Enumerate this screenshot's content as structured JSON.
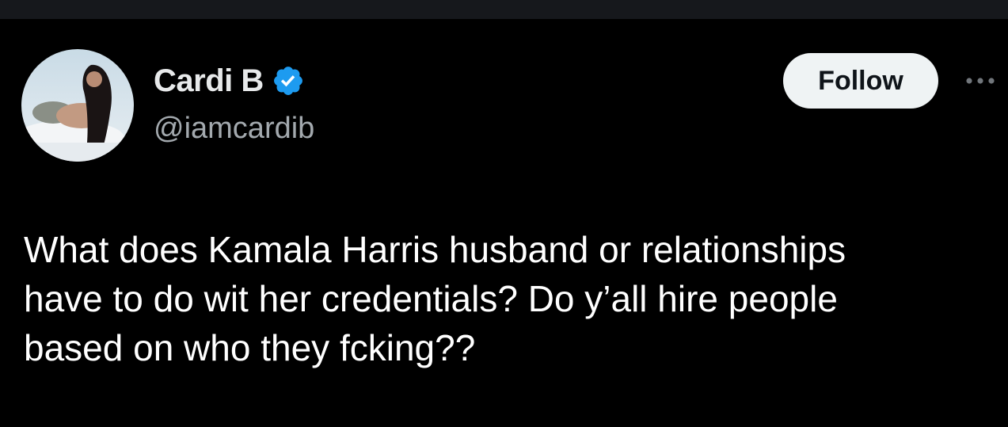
{
  "author": {
    "display_name": "Cardi B",
    "handle": "@iamcardib",
    "verified": true,
    "avatar_icon": "profile-photo-avatar"
  },
  "actions": {
    "follow_label": "Follow",
    "more_icon": "more-dots-icon"
  },
  "tweet": {
    "lines": [
      "What does Kamala Harris husband or relationships",
      "have to do wit her credentials? Do y’all hire people",
      "based on who they fcking??"
    ]
  },
  "colors": {
    "background": "#000000",
    "primary_text": "#e7e9ea",
    "secondary_text": "#a3a9ae",
    "verified_badge": "#1d9bf0",
    "follow_button_bg": "#eff3f4"
  }
}
